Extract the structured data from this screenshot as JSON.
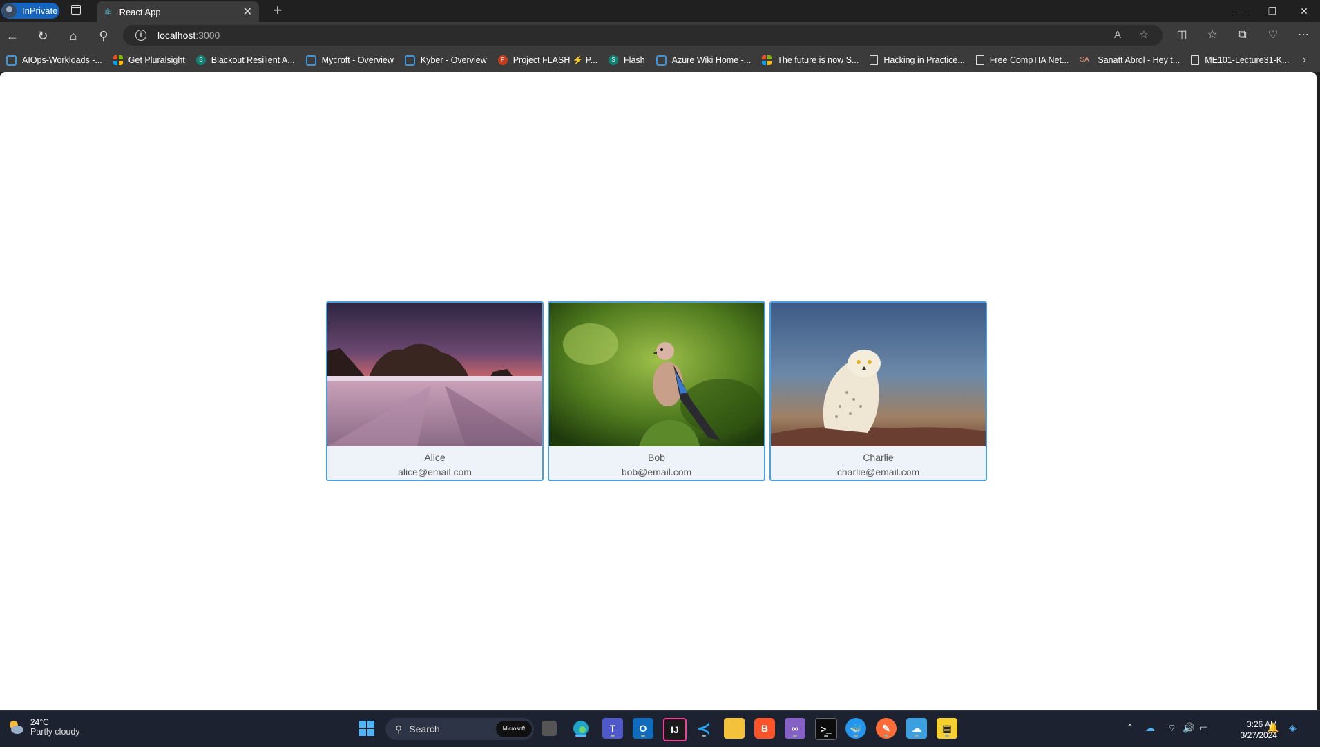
{
  "browser": {
    "inprivate_label": "InPrivate",
    "tab_title": "React App",
    "url_host": "localhost",
    "url_port": ":3000"
  },
  "bookmarks": [
    {
      "label": "AIOps-Workloads -...",
      "icon": "azure"
    },
    {
      "label": "Get Pluralsight",
      "icon": "ms"
    },
    {
      "label": "Blackout Resilient A...",
      "icon": "sp"
    },
    {
      "label": "Mycroft - Overview",
      "icon": "azure"
    },
    {
      "label": "Kyber - Overview",
      "icon": "azure"
    },
    {
      "label": "Project FLASH ⚡ P...",
      "icon": "ppt"
    },
    {
      "label": "Flash",
      "icon": "sp"
    },
    {
      "label": "Azure Wiki Home -...",
      "icon": "azure"
    },
    {
      "label": "The future is now S...",
      "icon": "ms"
    },
    {
      "label": "Hacking in Practice...",
      "icon": "doc"
    },
    {
      "label": "Free CompTIA Net...",
      "icon": "doc"
    },
    {
      "label": "Sanatt Abrol - Hey t...",
      "icon": "sa"
    },
    {
      "label": "ME101-Lecture31-K...",
      "icon": "doc"
    }
  ],
  "cards": [
    {
      "name": "Alice",
      "email": "alice@email.com",
      "image": "sea-arch-sunset"
    },
    {
      "name": "Bob",
      "email": "bob@email.com",
      "image": "jay-bird-on-moss"
    },
    {
      "name": "Charlie",
      "email": "charlie@email.com",
      "image": "snowy-owl"
    }
  ],
  "taskbar": {
    "weather_temp": "24°C",
    "weather_cond": "Partly cloudy",
    "search_label": "Search",
    "search_badge": "Microsoft",
    "time": "3:26 AM",
    "date": "3/27/2024"
  }
}
